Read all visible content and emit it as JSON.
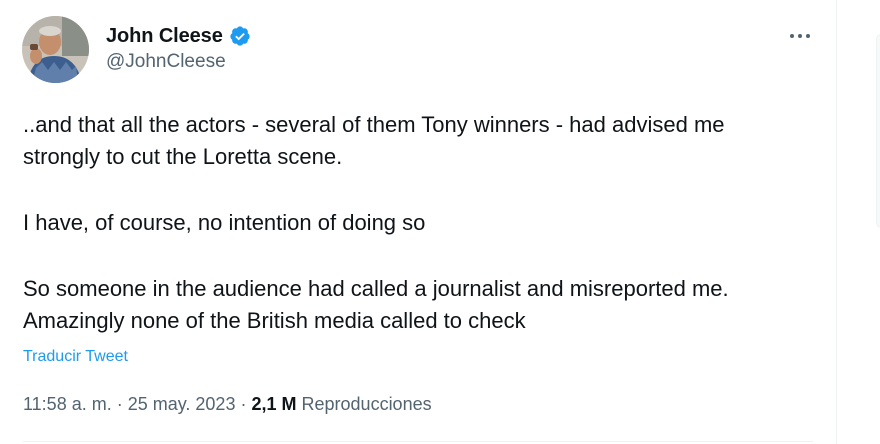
{
  "author": {
    "display_name": "John Cleese",
    "handle": "@JohnCleese",
    "verified": true,
    "avatar_icon": "profile-photo-icon"
  },
  "more_icon": "more-horizontal-icon",
  "tweet": {
    "paragraphs": [
      "..and that all the actors - several of them Tony winners - had advised me\nstrongly to cut the Loretta scene.",
      "I have, of course, no intention of doing so",
      "So someone in the audience had called a journalist and misreported me.\nAmazingly none of the British media called to check"
    ],
    "translate_label": "Traducir Tweet"
  },
  "meta": {
    "time": "11:58 a. m.",
    "separator": " · ",
    "date": "25 may. 2023",
    "views_count": "2,1 M",
    "views_label": "Reproducciones"
  },
  "colors": {
    "text": "#0f1419",
    "secondary": "#536471",
    "accent": "#1d9bf0",
    "border": "#eff3f4"
  }
}
